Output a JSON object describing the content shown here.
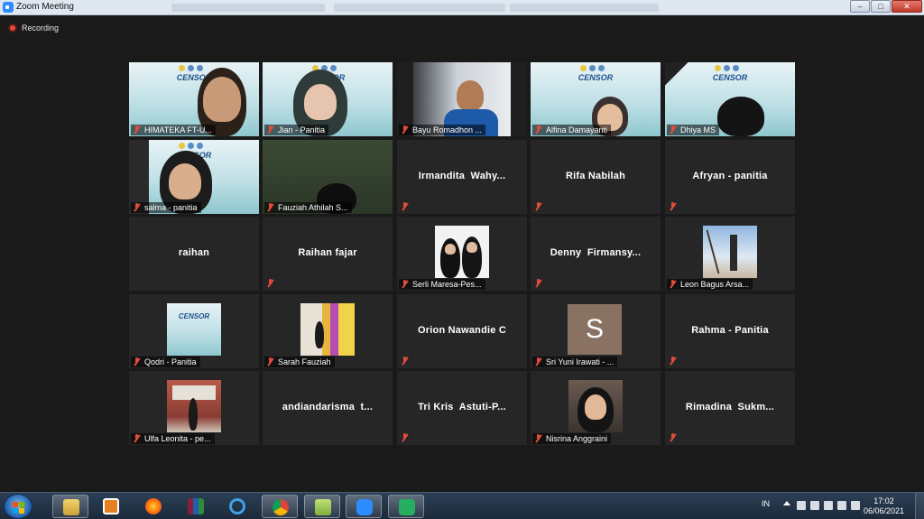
{
  "window": {
    "title": "Zoom Meeting",
    "controls": [
      "–",
      "□",
      "✕"
    ]
  },
  "recording": {
    "label": "Recording",
    "color": "#e34b3c"
  },
  "banner": {
    "title": "CENSOR"
  },
  "participants": [
    {
      "name": "HIMATEKA FT-U...",
      "display": "video"
    },
    {
      "name": "Jian - Panitia",
      "display": "video"
    },
    {
      "name": "Bayu Romadhon ...",
      "display": "video"
    },
    {
      "name": "Alfina Damayanti",
      "display": "video"
    },
    {
      "name": "Dhiya MS",
      "display": "video"
    },
    {
      "name": "salma - panitia",
      "display": "video"
    },
    {
      "name": "Fauziah Athilah S...",
      "display": "video"
    },
    {
      "name": "Irmandita  Wahy...",
      "display": "name"
    },
    {
      "name": "Rifa Nabilah",
      "display": "name"
    },
    {
      "name": "Afryan - panitia",
      "display": "name"
    },
    {
      "name": "raihan",
      "display": "name"
    },
    {
      "name": "Raihan fajar",
      "display": "name"
    },
    {
      "name": "Serli Maresa-Pes...",
      "display": "photo"
    },
    {
      "name": "Denny  Firmansy...",
      "display": "name"
    },
    {
      "name": "Leon Bagus Arsa...",
      "display": "photo"
    },
    {
      "name": "Qodri - Panitia",
      "display": "photo"
    },
    {
      "name": "Sarah Fauziah",
      "display": "photo"
    },
    {
      "name": "Orion Nawandie C",
      "display": "name"
    },
    {
      "name": "Sri Yuni Irawati - ...",
      "display": "initial",
      "initial": "S"
    },
    {
      "name": "Rahma - Panitia",
      "display": "name"
    },
    {
      "name": "Ulfa Leonita - pe...",
      "display": "photo"
    },
    {
      "name": "andiandarisma  t...",
      "display": "name"
    },
    {
      "name": "Tri Kris  Astuti-P...",
      "display": "name"
    },
    {
      "name": "Nisrina Anggraini",
      "display": "photo"
    },
    {
      "name": "Rimadina  Sukm...",
      "display": "name"
    }
  ],
  "taskbar": {
    "apps": [
      "explorer-icon",
      "media-player-icon",
      "firefox-icon",
      "winrar-icon",
      "internet-explorer-icon",
      "chrome-icon",
      "folder-icon",
      "zoom-icon",
      "phone-icon"
    ],
    "tray": {
      "language": "IN",
      "time": "17:02",
      "date": "06/06/2021"
    }
  }
}
